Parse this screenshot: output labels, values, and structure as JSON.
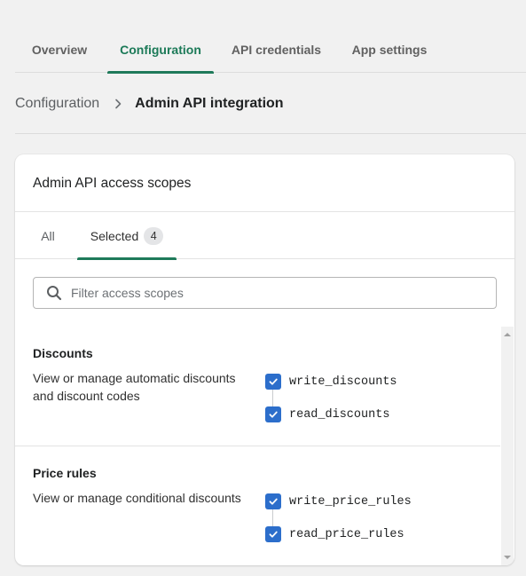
{
  "top_tabs": [
    {
      "label": "Overview",
      "active": false
    },
    {
      "label": "Configuration",
      "active": true
    },
    {
      "label": "API credentials",
      "active": false
    },
    {
      "label": "App settings",
      "active": false
    }
  ],
  "breadcrumb": {
    "parent": "Configuration",
    "current": "Admin API integration"
  },
  "card": {
    "title": "Admin API access scopes",
    "tabs": [
      {
        "label": "All",
        "active": false
      },
      {
        "label": "Selected",
        "count": "4",
        "active": true
      }
    ],
    "search": {
      "placeholder": "Filter access scopes",
      "value": ""
    },
    "sections": [
      {
        "title": "Discounts",
        "description": "View or manage automatic discounts and discount codes",
        "scopes": [
          {
            "name": "write_discounts",
            "checked": true
          },
          {
            "name": "read_discounts",
            "checked": true
          }
        ]
      },
      {
        "title": "Price rules",
        "description": "View or manage conditional discounts",
        "scopes": [
          {
            "name": "write_price_rules",
            "checked": true
          },
          {
            "name": "read_price_rules",
            "checked": true
          }
        ]
      }
    ]
  },
  "colors": {
    "accent": "#1f7a5a",
    "checkbox": "#2c6ecb",
    "background": "#f1f1f1"
  },
  "icons": {
    "breadcrumb_separator": "chevron-right-icon",
    "search": "search-icon",
    "checkbox": "checkmark-icon",
    "scroll_up": "arrow-up-icon",
    "scroll_down": "arrow-down-icon"
  }
}
